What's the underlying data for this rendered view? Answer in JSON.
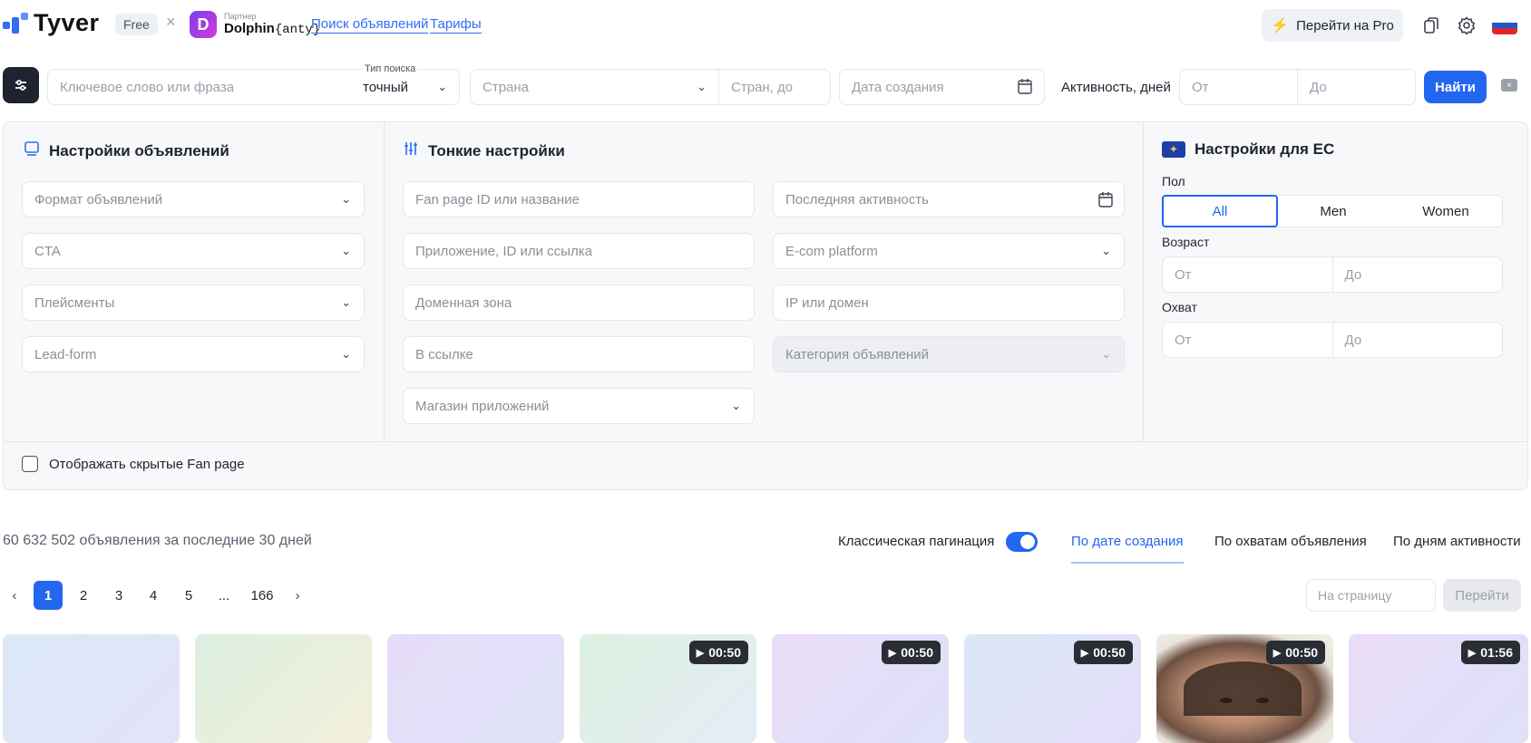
{
  "header": {
    "logo_text": "Tyver",
    "plan_badge": "Free",
    "times": "×",
    "partner_label": "Партнер",
    "partner_name": "Dolphin",
    "partner_suffix": "{anty}",
    "nav": [
      "Поиск объявлений",
      "Тарифы"
    ],
    "pro_button": "Перейти на Pro",
    "icons": [
      "bolt-icon",
      "bookmarks-icon",
      "gear-icon",
      "russia-flag-icon"
    ]
  },
  "search": {
    "keyword_placeholder": "Ключевое слово или фраза",
    "search_type_label": "Тип поиска",
    "search_type_value": "точный",
    "country_placeholder": "Страна",
    "countries_to_placeholder": "Стран, до",
    "date_placeholder": "Дата создания",
    "activity_label": "Активность, дней",
    "from_placeholder": "От",
    "to_placeholder": "До",
    "find_button": "Найти"
  },
  "ad_settings": {
    "title": "Настройки объявлений",
    "fields": [
      "Формат объявлений",
      "CTA",
      "Плейсменты",
      "Lead-form"
    ]
  },
  "fine_settings": {
    "title": "Тонкие настройки",
    "left_fields": [
      "Fan page ID или название",
      "Приложение, ID или ссылка",
      "Доменная зона",
      "В ссылке",
      "Магазин приложений"
    ],
    "right_fields": [
      "Последняя активность",
      "E-com platform",
      "IP или домен",
      "Категория объявлений"
    ]
  },
  "eu_settings": {
    "title": "Настройки для ЕС",
    "gender_label": "Пол",
    "gender_options": [
      "All",
      "Men",
      "Women"
    ],
    "age_label": "Возраст",
    "reach_label": "Охват",
    "from": "От",
    "to": "До"
  },
  "hidden_fanpage_label": "Отображать скрытые Fan page",
  "results": {
    "count_text": "60 632 502 объявления за последние 30 дней",
    "classic_pagination_label": "Классическая пагинация",
    "classic_pagination_on": true,
    "sort_tabs": [
      "По дате создания",
      "По охватам объявления",
      "По дням активности"
    ],
    "active_sort": 0
  },
  "pagination": {
    "pages": [
      "1",
      "2",
      "3",
      "4",
      "5",
      "...",
      "166"
    ],
    "current": "1",
    "per_page_placeholder": "На страницу",
    "go_button": "Перейти"
  },
  "cards": [
    {
      "duration": ""
    },
    {
      "duration": ""
    },
    {
      "duration": ""
    },
    {
      "duration": "00:50"
    },
    {
      "duration": "00:50"
    },
    {
      "duration": "00:50"
    },
    {
      "duration": "00:50"
    },
    {
      "duration": "01:56"
    }
  ],
  "colors": {
    "accent": "#2366f0",
    "dark_button": "#1f2330"
  }
}
